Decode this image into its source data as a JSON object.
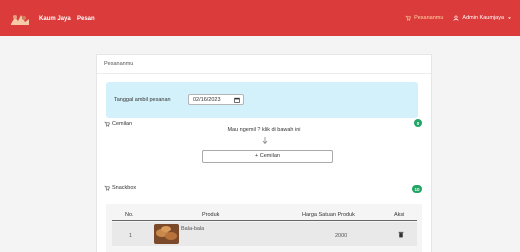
{
  "navbar": {
    "brand": "Kaum Jaya",
    "nav_link": "Pesan",
    "right_items": [
      {
        "icon": "cart-icon",
        "label": "Pesananmu"
      },
      {
        "icon": "user-icon",
        "label": "Admin Kaumjaya"
      }
    ],
    "color": "#dc3b3b"
  },
  "card": {
    "header": "Pesananmu",
    "date_label": "Tanggal ambil pesanan",
    "date_value": "02/16/2023",
    "cemilan": {
      "label": "Cemilan",
      "count": "0",
      "empty_message": "Mau ngemil ? klik di bawah ini",
      "add_button": "+ Cemilan"
    },
    "snackbox": {
      "label": "Snackbox",
      "count": "10",
      "columns": [
        "No.",
        "Produk",
        "Harga Satuan Produk",
        "Aksi"
      ],
      "rows": [
        {
          "no": "1",
          "product": "Bala-bala",
          "price": "2000"
        }
      ]
    }
  }
}
